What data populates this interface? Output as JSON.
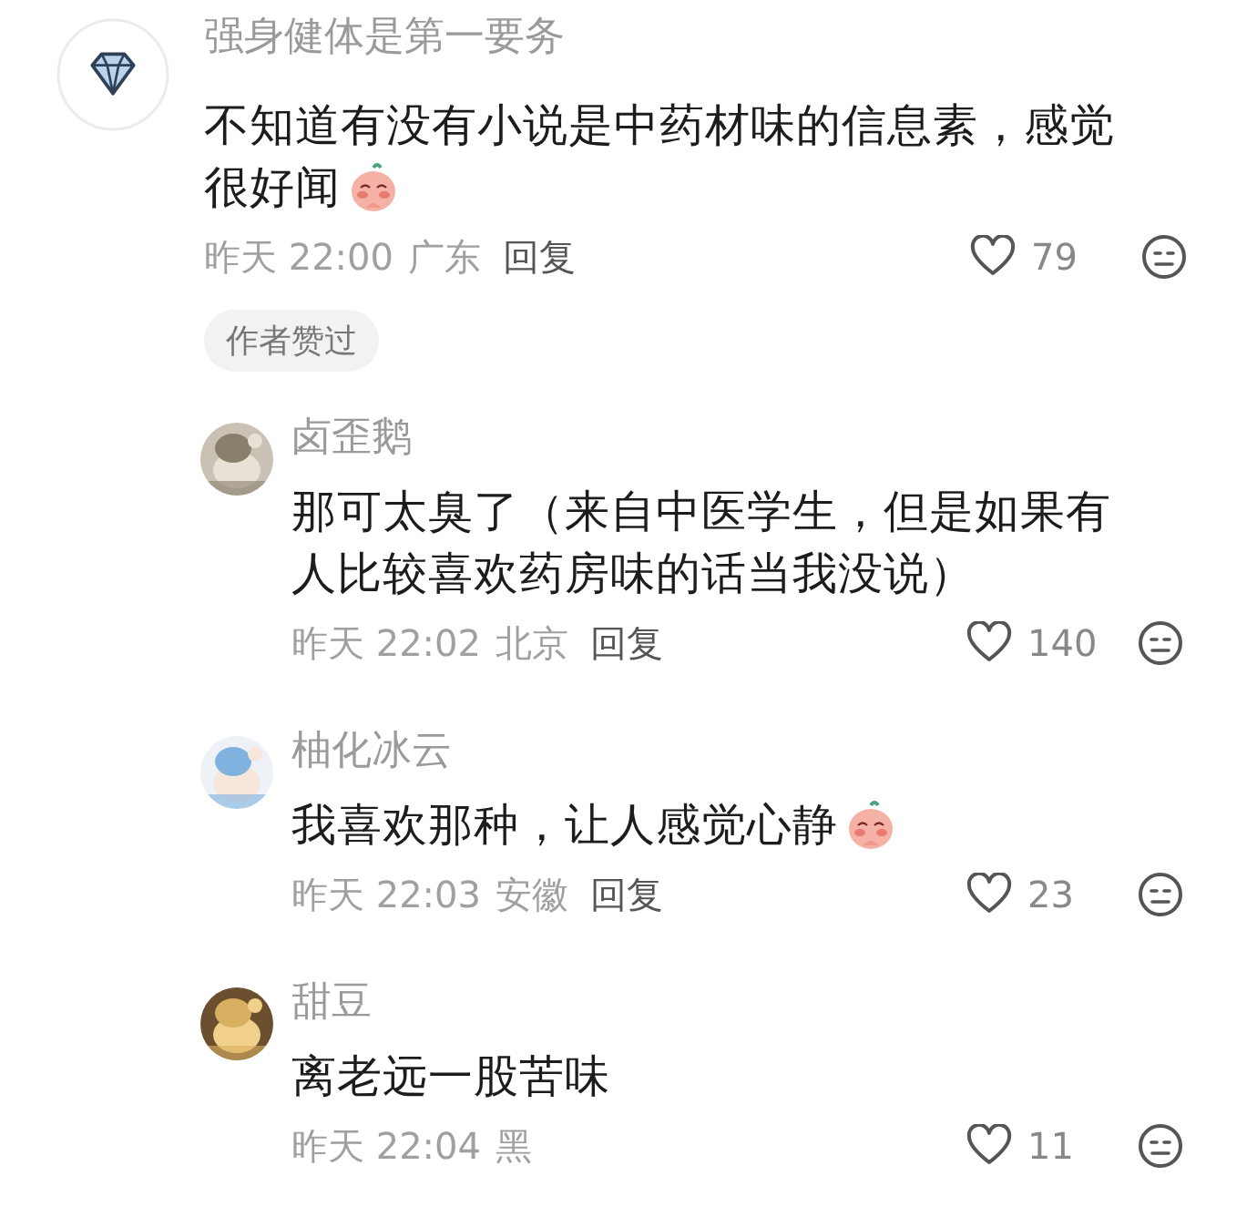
{
  "comments": [
    {
      "avatar": {
        "kind": "diamond"
      },
      "author": "强身健体是第一要务",
      "lines": [
        "不知道有没有小说是中药材味的信息素，感觉",
        "很好闻"
      ],
      "emoji": true,
      "time": "昨天 22:00",
      "location": "广东",
      "reply_label": "回复",
      "likes": "79",
      "badge": "作者赞过",
      "replies": [
        {
          "avatar": {
            "kind": "picture"
          },
          "author": "卤歪鹅",
          "lines": [
            "那可太臭了（来自中医学生，但是如果有",
            "人比较喜欢药房味的话当我没说）"
          ],
          "emoji": false,
          "time": "昨天 22:02",
          "location": "北京",
          "reply_label": "回复",
          "likes": "140"
        },
        {
          "avatar": {
            "kind": "picture"
          },
          "author": "柚化冰云",
          "lines": [
            "我喜欢那种，让人感觉心静"
          ],
          "emoji": true,
          "time": "昨天 22:03",
          "location": "安徽",
          "reply_label": "回复",
          "likes": "23"
        },
        {
          "avatar": {
            "kind": "picture"
          },
          "author": "甜豆",
          "lines": [
            "离老远一股苦味"
          ],
          "emoji": false,
          "time": "昨天 22:04",
          "location": "黑",
          "likes": "11"
        }
      ]
    }
  ]
}
